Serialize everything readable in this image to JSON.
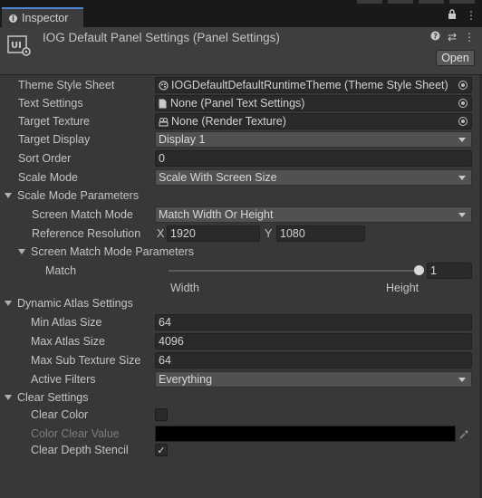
{
  "window": {
    "tab_label": "Inspector"
  },
  "header": {
    "title": "IOG Default Panel Settings (Panel Settings)",
    "open_label": "Open"
  },
  "props": {
    "theme_style_sheet": {
      "label": "Theme Style Sheet",
      "value": "IOGDefaultDefaultRuntimeTheme (Theme Style Sheet)"
    },
    "text_settings": {
      "label": "Text Settings",
      "value": "None (Panel Text Settings)"
    },
    "target_texture": {
      "label": "Target Texture",
      "value": "None (Render Texture)"
    },
    "target_display": {
      "label": "Target Display",
      "value": "Display 1"
    },
    "sort_order": {
      "label": "Sort Order",
      "value": "0"
    },
    "scale_mode": {
      "label": "Scale Mode",
      "value": "Scale With Screen Size"
    }
  },
  "scale_mode_params": {
    "header": "Scale Mode Parameters",
    "screen_match_mode": {
      "label": "Screen Match Mode",
      "value": "Match Width Or Height"
    },
    "reference_resolution": {
      "label": "Reference Resolution",
      "x_label": "X",
      "x": "1920",
      "y_label": "Y",
      "y": "1080"
    },
    "screen_match_mode_params": {
      "header": "Screen Match Mode Parameters",
      "match": {
        "label": "Match",
        "value": "1",
        "min_label": "Width",
        "max_label": "Height",
        "fraction": 1.0
      }
    }
  },
  "dynamic_atlas": {
    "header": "Dynamic Atlas Settings",
    "min_atlas_size": {
      "label": "Min Atlas Size",
      "value": "64"
    },
    "max_atlas_size": {
      "label": "Max Atlas Size",
      "value": "4096"
    },
    "max_sub_texture_size": {
      "label": "Max Sub Texture Size",
      "value": "64"
    },
    "active_filters": {
      "label": "Active Filters",
      "value": "Everything"
    }
  },
  "clear_settings": {
    "header": "Clear Settings",
    "clear_color": {
      "label": "Clear Color",
      "checked": false
    },
    "color_clear_value": {
      "label": "Color Clear Value",
      "color": "#000000"
    },
    "clear_depth_stencil": {
      "label": "Clear Depth Stencil",
      "checked": true
    }
  }
}
